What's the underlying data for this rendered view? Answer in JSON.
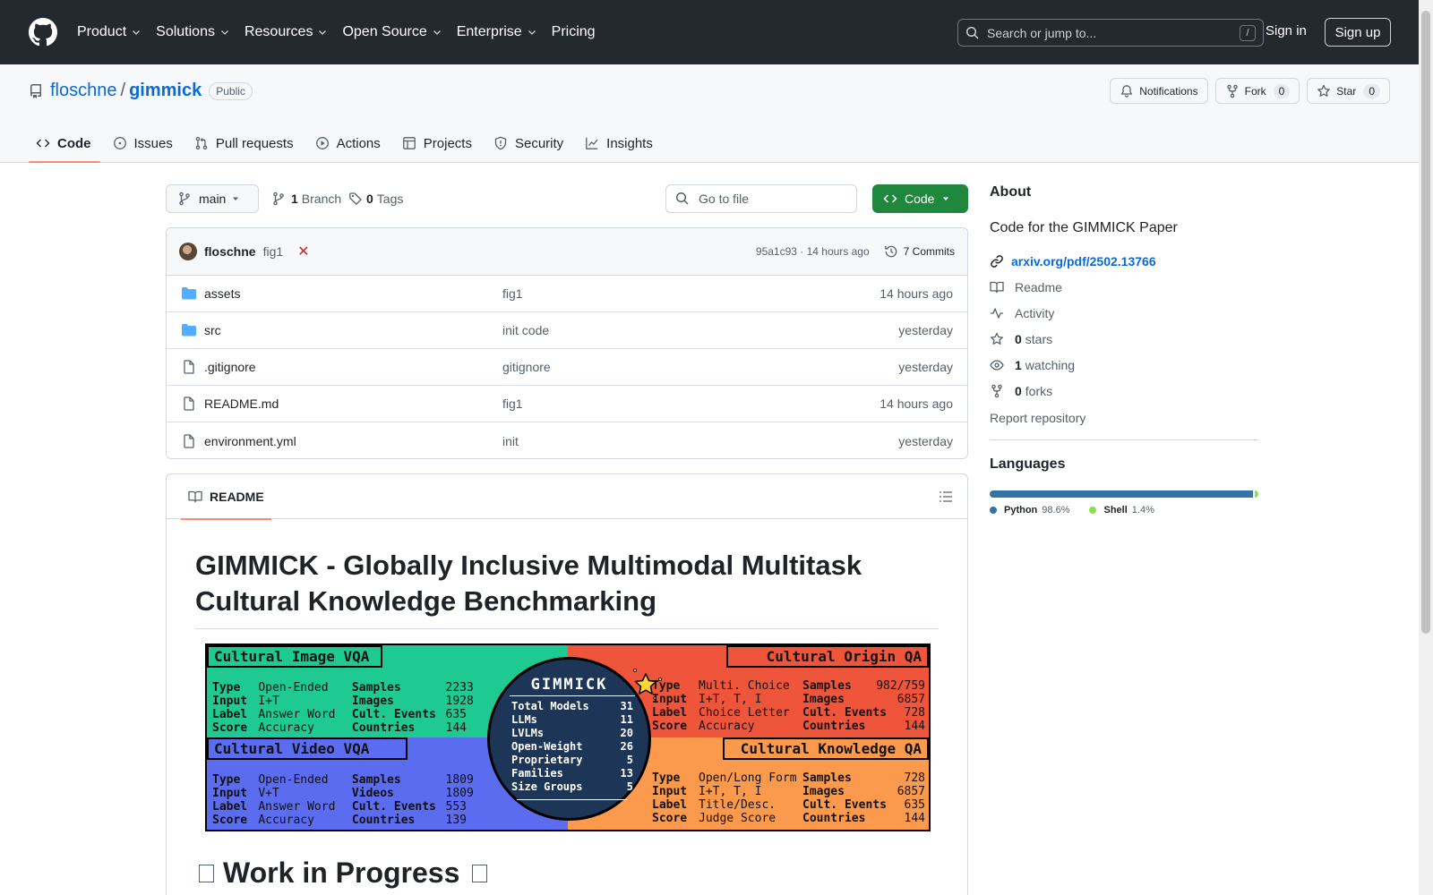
{
  "header": {
    "nav": [
      "Product",
      "Solutions",
      "Resources",
      "Open Source",
      "Enterprise",
      "Pricing"
    ],
    "search_placeholder": "Search or jump to...",
    "search_key": "/",
    "sign_in": "Sign in",
    "sign_up": "Sign up"
  },
  "repo": {
    "owner": "floschne",
    "separator": "/",
    "name": "gimmick",
    "visibility": "Public",
    "notifications": "Notifications",
    "fork_label": "Fork",
    "fork_count": "0",
    "star_label": "Star",
    "star_count": "0",
    "tabs": [
      "Code",
      "Issues",
      "Pull requests",
      "Actions",
      "Projects",
      "Security",
      "Insights"
    ]
  },
  "branch": {
    "current": "main",
    "branch_count": "1",
    "branch_label": "Branch",
    "tag_count": "0",
    "tag_label": "Tags",
    "goto_placeholder": "Go to file",
    "code_button": "Code"
  },
  "commit": {
    "author": "floschne",
    "message": "fig1",
    "status": "✕",
    "meta": "95a1c93 · 14 hours ago",
    "commits": "7 Commits"
  },
  "files": [
    {
      "name": "assets",
      "type": "dir",
      "commit": "fig1",
      "age": "14 hours ago"
    },
    {
      "name": "src",
      "type": "dir",
      "commit": "init code",
      "age": "yesterday"
    },
    {
      "name": ".gitignore",
      "type": "file",
      "commit": "gitignore",
      "age": "yesterday"
    },
    {
      "name": "README.md",
      "type": "file",
      "commit": "fig1",
      "age": "14 hours ago"
    },
    {
      "name": "environment.yml",
      "type": "file",
      "commit": "init",
      "age": "yesterday"
    }
  ],
  "readme": {
    "tab": "README",
    "title": "GIMMICK - Globally Inclusive Multimodal Multitask Cultural Knowledge Benchmarking",
    "h2": "Work in Progress"
  },
  "banner": {
    "image_vqa": {
      "title": "Cultural Image VQA",
      "rows": [
        [
          "Type",
          "Open-Ended",
          "Samples",
          "2233"
        ],
        [
          "Input",
          "I+T",
          "Images",
          "1928"
        ],
        [
          "Label",
          "Answer Word",
          "Cult. Events",
          "635"
        ],
        [
          "Score",
          "Accuracy",
          "Countries",
          "144"
        ]
      ]
    },
    "origin_qa": {
      "title": "Cultural Origin QA",
      "rows": [
        [
          "Type",
          "Multi. Choice",
          "Samples",
          "982/759"
        ],
        [
          "Input",
          "I+T, T, I",
          "Images",
          "6857"
        ],
        [
          "Label",
          "Choice Letter",
          "Cult. Events",
          "728"
        ],
        [
          "Score",
          "Accuracy",
          "Countries",
          "144"
        ]
      ]
    },
    "video_vqa": {
      "title": "Cultural Video VQA",
      "rows": [
        [
          "Type",
          "Open-Ended",
          "Samples",
          "1809"
        ],
        [
          "Input",
          "V+T",
          "Videos",
          "1809"
        ],
        [
          "Label",
          "Answer Word",
          "Cult. Events",
          "553"
        ],
        [
          "Score",
          "Accuracy",
          "Countries",
          "139"
        ]
      ]
    },
    "knowledge_qa": {
      "title": "Cultural Knowledge QA",
      "rows": [
        [
          "Type",
          "Open/Long Form",
          "Samples",
          "728"
        ],
        [
          "Input",
          "I+T, T, I",
          "Images",
          "6857"
        ],
        [
          "Label",
          "Title/Desc.",
          "Cult. Events",
          "635"
        ],
        [
          "Score",
          "Judge Score",
          "Countries",
          "144"
        ]
      ]
    },
    "centre": {
      "title": "GIMMICK",
      "stats": [
        [
          "Total Models",
          "31"
        ],
        [
          "LLMs",
          "11"
        ],
        [
          "LVLMs",
          "20"
        ],
        [
          "Open-Weight",
          "26"
        ],
        [
          "Proprietary",
          "5"
        ],
        [
          "Families",
          "13"
        ],
        [
          "Size Groups",
          "5"
        ]
      ]
    }
  },
  "about": {
    "title": "About",
    "description": "Code for the GIMMICK Paper",
    "link": "arxiv.org/pdf/2502.13766",
    "readme": "Readme",
    "activity": "Activity",
    "stars_count": "0",
    "stars_label": "stars",
    "watching_count": "1",
    "watching_label": "watching",
    "forks_count": "0",
    "forks_label": "forks",
    "report": "Report repository"
  },
  "languages": {
    "title": "Languages",
    "items": [
      {
        "name": "Python",
        "percent": "98.6%",
        "value": 98.6,
        "color": "#3572A5"
      },
      {
        "name": "Shell",
        "percent": "1.4%",
        "value": 1.4,
        "color": "#89e051"
      }
    ]
  }
}
